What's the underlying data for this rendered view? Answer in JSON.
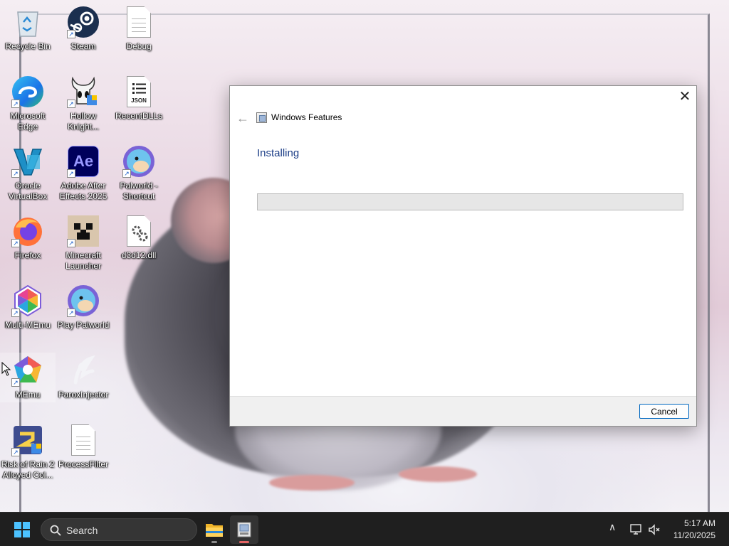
{
  "desktop": {
    "icons": [
      {
        "label": "Recycle Bin",
        "icon": "recycle-bin-icon"
      },
      {
        "label": "Steam",
        "icon": "steam-icon"
      },
      {
        "label": "Debug",
        "icon": "document-icon"
      },
      {
        "label": "Microsoft Edge",
        "icon": "edge-icon"
      },
      {
        "label": "Hollow Knight...",
        "icon": "hollow-knight-icon"
      },
      {
        "label": "RecentDLLs",
        "icon": "json-file-icon"
      },
      {
        "label": "Oracle VirtualBox",
        "icon": "virtualbox-icon"
      },
      {
        "label": "Adobe After Effects 2025",
        "icon": "after-effects-icon"
      },
      {
        "label": "Palworld - Shortcut",
        "icon": "palworld-icon"
      },
      {
        "label": "Firefox",
        "icon": "firefox-icon"
      },
      {
        "label": "Minecraft Launcher",
        "icon": "minecraft-icon"
      },
      {
        "label": "d3d12.dll",
        "icon": "dll-file-icon"
      },
      {
        "label": "Multi-MEmu",
        "icon": "multi-memu-icon"
      },
      {
        "label": "Play Palworld",
        "icon": "palworld-icon"
      },
      {
        "label": "MEmu",
        "icon": "memu-icon"
      },
      {
        "label": "ParoxInjector",
        "icon": "parox-icon"
      },
      {
        "label": "Risk of Rain 2 Alloyed Col...",
        "icon": "risk-of-rain-icon"
      },
      {
        "label": "ProcessFilter",
        "icon": "document-icon"
      }
    ],
    "ae_text": "Ae",
    "json_text": "JSON"
  },
  "dialog": {
    "title": "Windows Features",
    "heading": "Installing",
    "progress_fraction": 0.0,
    "cancel_label": "Cancel",
    "close_glyph": "✕",
    "back_glyph": "←"
  },
  "taskbar": {
    "search_placeholder": "Search",
    "apps": [
      {
        "name": "file-explorer",
        "active": false
      },
      {
        "name": "windows-features",
        "active": true
      }
    ],
    "tray": {
      "chevron_glyph": "∧",
      "time": "5:17 AM",
      "date": "11/20/2025"
    }
  },
  "colors": {
    "accent": "#0067c0",
    "heading": "#1c3e87",
    "taskbar": "#1f1f1f",
    "start_logo": "#4cc2ff"
  }
}
